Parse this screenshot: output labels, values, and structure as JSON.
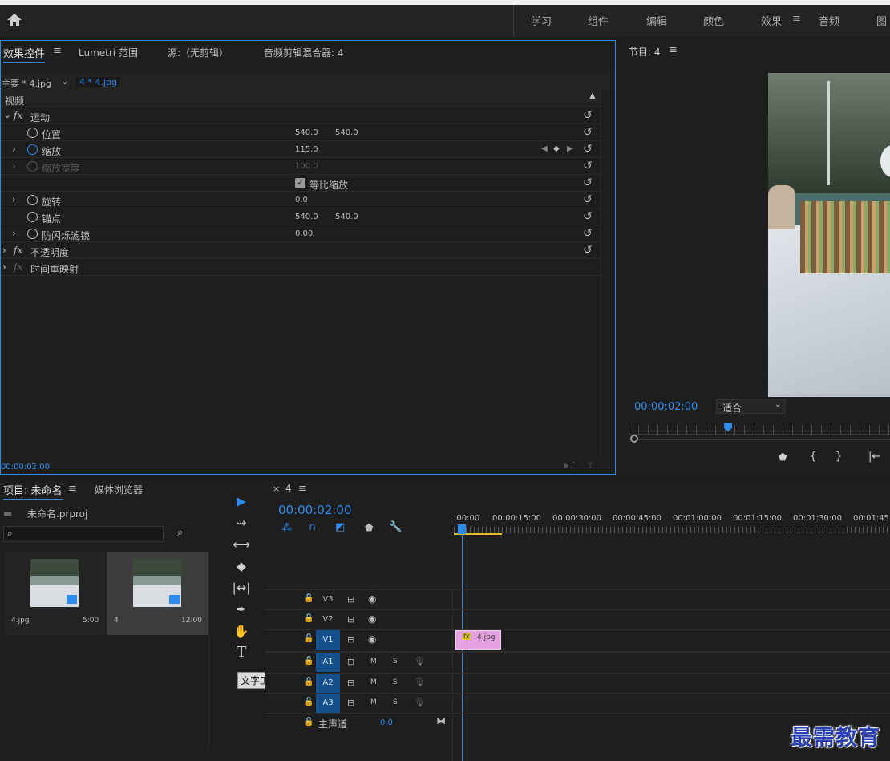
{
  "workspaces": [
    "学习",
    "组件",
    "编辑",
    "颜色",
    "效果",
    "音频",
    "图"
  ],
  "active_workspace": "效果",
  "effect_controls": {
    "tabs": [
      "效果控件",
      "Lumetri 范围",
      "源:（无剪辑）",
      "音频剪辑混合器: 4"
    ],
    "menu_icon": "≡",
    "master_clip": "主要 * 4.jpg",
    "sequence_clip": "4 * 4.jpg",
    "video_label": "视频",
    "motion": "运动",
    "props": {
      "position": {
        "label": "位置",
        "x": "540.0",
        "y": "540.0"
      },
      "scale": {
        "label": "缩放",
        "value": "115.0"
      },
      "scale_width": {
        "label": "缩放宽度",
        "value": "100.0"
      },
      "uniform": {
        "label": "等比缩放"
      },
      "rotation": {
        "label": "旋转",
        "value": "0.0"
      },
      "anchor": {
        "label": "锚点",
        "x": "540.0",
        "y": "540.0"
      },
      "flicker": {
        "label": "防闪烁滤镜",
        "value": "0.00"
      }
    },
    "opacity": "不透明度",
    "time_remap": "时间重映射",
    "timecode": "00:00:02:00"
  },
  "program": {
    "title": "节目: 4",
    "timecode": "00:00:02:00",
    "fit": "适合"
  },
  "project": {
    "tabs": [
      "项目: 未命名",
      "媒体浏览器"
    ],
    "file": "未命名.prproj",
    "items": [
      {
        "name": "4.jpg",
        "duration": "5:00"
      },
      {
        "name": "4",
        "duration": "12:00"
      }
    ]
  },
  "timeline": {
    "tab": "4",
    "timecode": "00:00:02:00",
    "ruler": [
      ":00:00",
      "00:00:15:00",
      "00:00:30:00",
      "00:00:45:00",
      "00:01:00:00",
      "00:01:15:00",
      "00:01:30:00",
      "00:01:45:"
    ],
    "video_tracks": [
      "V3",
      "V2",
      "V1"
    ],
    "audio_tracks": [
      "A1",
      "A2",
      "A3"
    ],
    "master": "主声道",
    "master_value": "0.0",
    "clip": "4.jpg",
    "M": "M",
    "S": "S"
  },
  "tooltip": "文字工具 (T)",
  "watermark": "最需教育"
}
